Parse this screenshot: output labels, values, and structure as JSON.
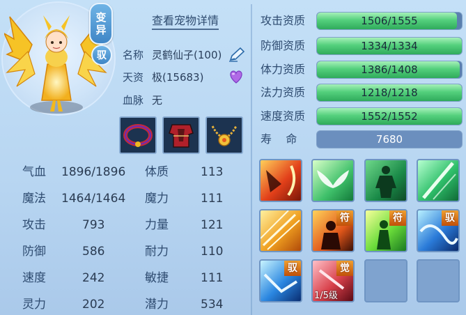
{
  "header": {
    "detail_link": "查看宠物详情"
  },
  "badges": {
    "mutation": [
      "变",
      "异"
    ],
    "tame": "驭"
  },
  "pet_info": {
    "name_label": "名称",
    "name_value": "灵鹤仙子(100)",
    "aptitude_label": "天资",
    "aptitude_value": "极(15683)",
    "bloodline_label": "血脉",
    "bloodline_value": "无"
  },
  "equipment": [
    "red-collar",
    "red-armor",
    "gold-necklace"
  ],
  "stats": [
    {
      "label": "气血",
      "value": "1896/1896"
    },
    {
      "label": "魔法",
      "value": "1464/1464"
    },
    {
      "label": "攻击",
      "value": "793"
    },
    {
      "label": "防御",
      "value": "586"
    },
    {
      "label": "速度",
      "value": "242"
    },
    {
      "label": "灵力",
      "value": "202"
    }
  ],
  "attributes": [
    {
      "label": "体质",
      "value": "113"
    },
    {
      "label": "魔力",
      "value": "111"
    },
    {
      "label": "力量",
      "value": "121"
    },
    {
      "label": "耐力",
      "value": "110"
    },
    {
      "label": "敏捷",
      "value": "111"
    },
    {
      "label": "潜力",
      "value": "534"
    }
  ],
  "aptitudes": [
    {
      "label": "攻击资质",
      "text": "1506/1555",
      "current": 1506,
      "max": 1555
    },
    {
      "label": "防御资质",
      "text": "1334/1334",
      "current": 1334,
      "max": 1334
    },
    {
      "label": "体力资质",
      "text": "1386/1408",
      "current": 1386,
      "max": 1408
    },
    {
      "label": "法力资质",
      "text": "1218/1218",
      "current": 1218,
      "max": 1218
    },
    {
      "label": "速度资质",
      "text": "1552/1552",
      "current": 1552,
      "max": 1552
    }
  ],
  "lifespan": {
    "label": "寿    命",
    "value": "7680"
  },
  "skills": [
    {
      "icon": "fire-claw-icon",
      "tag": ""
    },
    {
      "icon": "wings-icon",
      "tag": ""
    },
    {
      "icon": "green-figure-icon",
      "tag": ""
    },
    {
      "icon": "green-slash-icon",
      "tag": ""
    },
    {
      "icon": "flame-burst-icon",
      "tag": ""
    },
    {
      "icon": "warrior-fire-icon",
      "tag": "符"
    },
    {
      "icon": "green-aura-icon",
      "tag": "符"
    },
    {
      "icon": "blue-wave-icon",
      "tag": "驭"
    },
    {
      "icon": "blue-crystal-icon",
      "tag": "驭"
    },
    {
      "icon": "red-awaken-icon",
      "tag": "觉",
      "level": "1/5级"
    },
    {
      "icon": "empty-slot",
      "tag": ""
    },
    {
      "icon": "empty-slot",
      "tag": ""
    }
  ],
  "colors": {
    "bar_green": "#54d07d",
    "bar_track": "#5a7fae",
    "panel_bg": "#b7d5f1",
    "text_dark": "#2e4b70"
  }
}
